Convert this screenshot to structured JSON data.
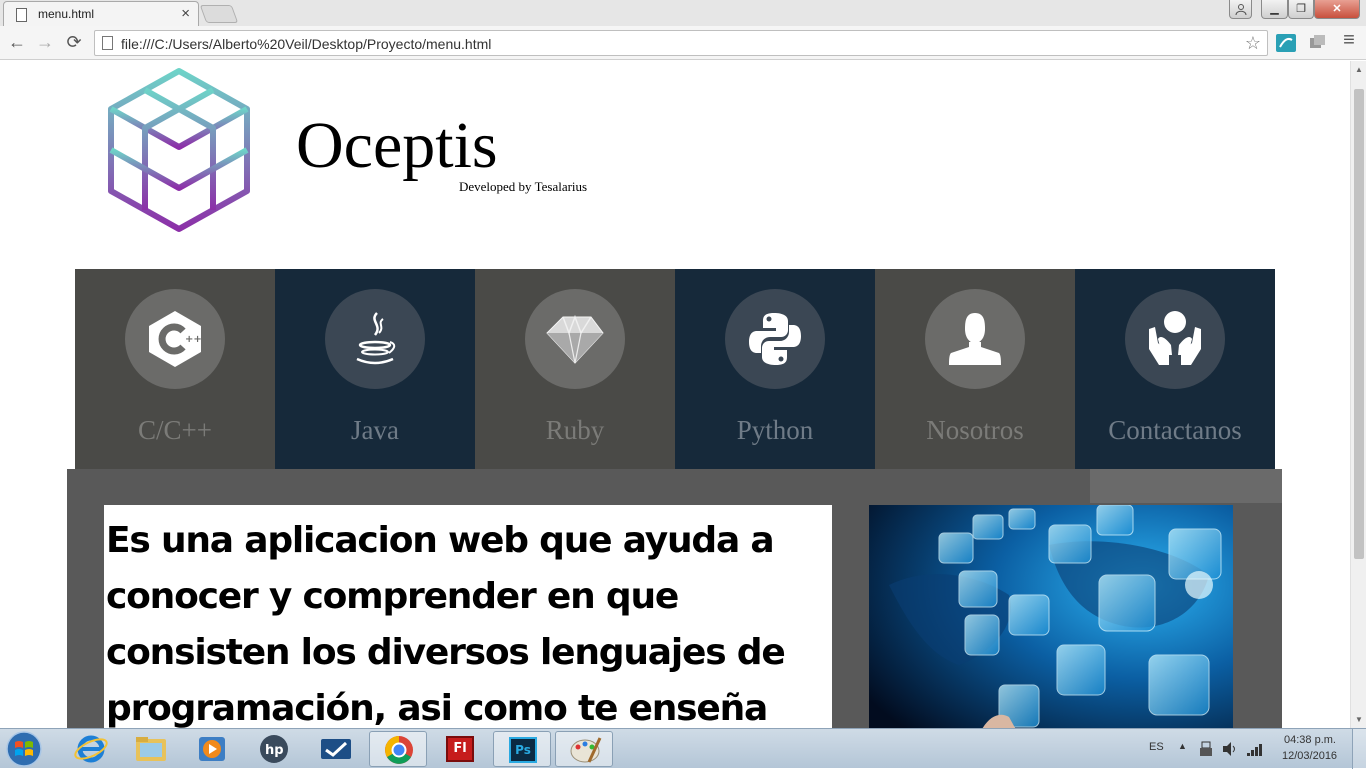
{
  "browser": {
    "tab_title": "menu.html",
    "tab_close": "×",
    "url": "file:///C:/Users/Alberto%20Veil/Desktop/Proyecto/menu.html",
    "nav": {
      "back": "←",
      "forward": "→",
      "reload": "⟳",
      "menu": "≡",
      "star": "☆"
    },
    "window_buttons": {
      "minimize": "▁",
      "restore": "❐",
      "close": "✕"
    }
  },
  "header": {
    "brand": "Oceptis",
    "tagline": "Developed by Tesalarius"
  },
  "menu": {
    "items": [
      {
        "label": "C/C++",
        "icon": "cpp-icon"
      },
      {
        "label": "Java",
        "icon": "java-icon"
      },
      {
        "label": "Ruby",
        "icon": "ruby-icon"
      },
      {
        "label": "Python",
        "icon": "python-icon"
      },
      {
        "label": "Nosotros",
        "icon": "user-icon"
      },
      {
        "label": "Contactanos",
        "icon": "hands-icon"
      }
    ]
  },
  "content": {
    "description": "Es una aplicacion web que ayuda a conocer y comprender en que consisten los diversos lenguajes de programación, asi como te enseña las instrucciones"
  },
  "colors": {
    "menu_gray": "#4a4a47",
    "menu_navy": "#16293a",
    "content_bg": "#595959"
  },
  "taskbar": {
    "language": "ES",
    "time": "04:38 p.m.",
    "date": "12/03/2016",
    "apps": [
      "internet-explorer-icon",
      "file-explorer-icon",
      "media-player-icon",
      "hp-icon",
      "task-app-icon",
      "chrome-icon",
      "flash-icon",
      "photoshop-icon",
      "paint-icon"
    ],
    "flash_label": "Fl",
    "photoshop_label": "Ps"
  }
}
